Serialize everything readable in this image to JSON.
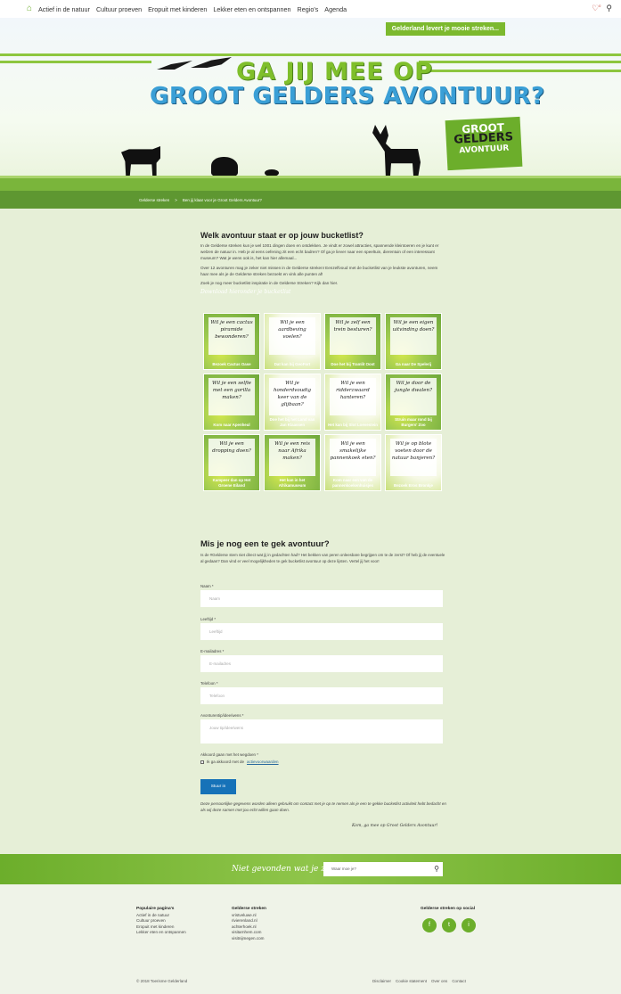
{
  "nav": {
    "items": [
      "Actief in de natuur",
      "Cultuur proeven",
      "Eropuit met kinderen",
      "Lekker eten en ontspannen",
      "Regio's",
      "Agenda"
    ],
    "favorites_count": "0"
  },
  "hero": {
    "slogan": "Gelderland levert je mooie streken...",
    "title_line1": "GA JIJ MEE OP",
    "title_line2": "GROOT GELDERS AVONTUUR?",
    "logo_line1": "GROOT",
    "logo_line2": "GELDERS",
    "logo_line3": "AVONTUUR"
  },
  "breadcrumb": [
    "Gelderse streken",
    ">",
    "Ben jij klaar voor je Groot Gelders Avontuur?"
  ],
  "intro": {
    "heading": "Welk avontuur staat er op jouw bucketlist?",
    "p1": "In de Gelderse streken kun je wel 1001 dingen doen en ontdekken. Je vindt er zowel attracties, spannende kleintoeren en je kunt er welzen de natuur in. Heb je al eens oefening zit een echt badren? Of ga je liever naar een speeltuin, dierentuin of een interessant museum? Wat je wens ook is, het kan hier allemaal...",
    "p2": "Over 12 avonturen mag je zeker niet missen in de Gelderse streken! Eenzelfvoud met de bucketlist van je leukste avonturen, neem haar mee als je de Gelderse streken bezoekt en vink alle punten af!",
    "p3": "Zoek je nog meer bucketlist inspiratie in de Gelderse Streken? Kijk dan hier.",
    "download": "Download hieronder je bucketlist"
  },
  "tiles": [
    {
      "q": "Wil je een cactus piramide bewonderen?",
      "cap": "Bezoek Cactus Oase",
      "light": false
    },
    {
      "q": "Wil je een aardbeving voelen?",
      "cap": "Dat kan bij GeoFort",
      "light": true
    },
    {
      "q": "Wil je zelf een trein besturen?",
      "cap": "Doe het bij Tramlit Oost",
      "light": false
    },
    {
      "q": "Wil je een eigen uitvinding doen?",
      "cap": "Ga naar De Spelerij",
      "light": false
    },
    {
      "q": "Wil je een selfie met een gorilla maken?",
      "cap": "Kom naar Apenheul",
      "light": false
    },
    {
      "q": "Wil je honderdvoudig keer van de glijbaan?",
      "cap": "Doe het bij het Land van Jan Klaassen",
      "light": true
    },
    {
      "q": "Wil je een ridderzwaard hanteren?",
      "cap": "Het kan bij Slot Loevestein",
      "light": true
    },
    {
      "q": "Wil je door de jungle dwalen?",
      "cap": "Struin maar rond bij Burgers' Zoo",
      "light": false
    },
    {
      "q": "Wil je een dropping doen?",
      "cap": "Kampeer dan op Het Groene Eiland",
      "light": false
    },
    {
      "q": "Wil je een reis naar Afrika maken?",
      "cap": "Het kan in het Afrikamuseum",
      "light": false
    },
    {
      "q": "Wil je een smakelijke pannenkoek eten?",
      "cap": "Kom naar een van de pannenkoekenhuisjes",
      "light": true
    },
    {
      "q": "Wil je op blote voeten door de natuur banjeren?",
      "cap": "Bezoek Eros Bronkje",
      "light": true
    }
  ],
  "form": {
    "title": "Mis je nog een te gek avontuur?",
    "intro": "Is de #Gelderse stem niet direct wat jij in gedachten had? Het bekken van peren onleesbare begrijpen om te de zerst? Of heb jij de eventuele al gedaan? Dan vind er veel mogelijkheden te gek bucketlist avontuur op deze lijsten. Vertel jij het voor!",
    "fields": [
      {
        "label": "Naam *",
        "placeholder": "Naam"
      },
      {
        "label": "Leeftijd *",
        "placeholder": "Leeftijd"
      },
      {
        "label": "E-mailadres *",
        "placeholder": "E-mailadres"
      },
      {
        "label": "Telefoon *",
        "placeholder": "Telefoon"
      },
      {
        "label": "Avonturentip/idee/wens *",
        "placeholder": "Jouw tip/idee/wens"
      }
    ],
    "terms_label": "Akkoord gaan met het wegdoen *",
    "terms_checkbox": "Ik ga akkoord met de",
    "terms_link": "actievoorwaarden",
    "submit": "Stuur in",
    "disclaimer": "Deze persoonlijke gegevens worden alleen gebruikt om contact met je op te nemen als je een te gekke bucketlist activiteit hebt bedacht en als wij deze samen met jou echt willen gaan doen.",
    "signoff": "Kom, ga mee op Groot Gelders Avontuur!"
  },
  "search": {
    "label": "Niet gevonden wat je zocht?",
    "placeholder": "Waar moe je?"
  },
  "footer": {
    "col1_title": "Populaire pagina's",
    "col1": [
      "Actief in de natuur",
      "Cultuur proeven",
      "Eropuit met kinderen",
      "Lekker eten en ontspannen"
    ],
    "col2_title": "Gelderse streken",
    "col2": [
      "vristveluwe.nl",
      "rivierenland.nl",
      "achterhoek.nl",
      "visitarnhem.com",
      "visitnijmegen.com"
    ],
    "col3_title": "Gelderse streken op social",
    "social": [
      "f",
      "t",
      "i"
    ],
    "copyright": "© 2018 Toerisme Gelderland",
    "bottom_links": [
      "Disclaimer",
      "Cookie statement",
      "Over ons",
      "Contact"
    ]
  }
}
